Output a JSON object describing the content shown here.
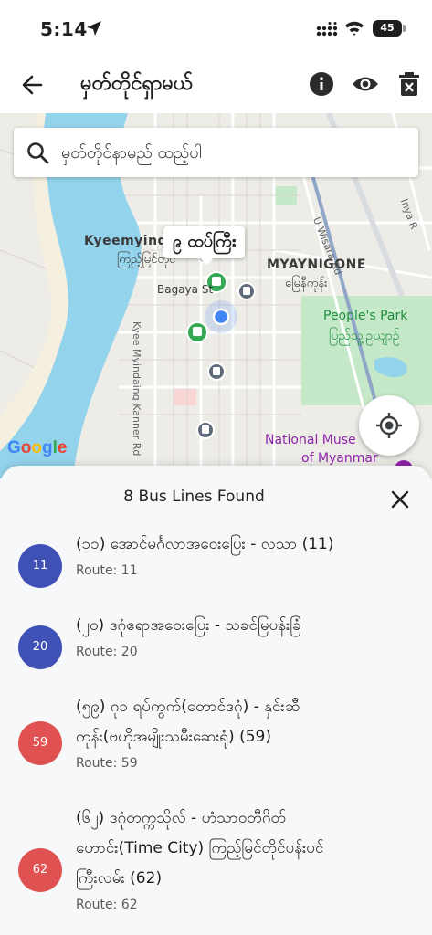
{
  "status_bar": {
    "time": "5:14",
    "battery": "45"
  },
  "app_bar": {
    "title": "မှတ်တိုင်ရှာမယ်"
  },
  "search": {
    "placeholder": "မှတ်တိုင်နာမည် ထည့်ပါ"
  },
  "map": {
    "callout": "၉ ထပ်ကြီး",
    "labels": {
      "kyeemyindaing": "Kyeemyinda",
      "kyeemyindaing_my": "ကြည့်မြင်တိုင်",
      "bagaya": "Bagaya St",
      "myaynigone": "MYAYNIGONE",
      "myaynigone_my": "မြေနီကုန်း",
      "peoples_park": "People's Park",
      "peoples_park_my": "ပြည်သူ့ဥယျာဉ်",
      "national_museum_1": "National Muse",
      "national_museum_2": "of Myanmar",
      "u_wisara": "U Wisara Rd",
      "inya": "Inya R",
      "kyee_myindaing_kanner": "Kyee Myindaing Kanner Rd"
    },
    "google": [
      "G",
      "o",
      "o",
      "g",
      "l",
      "e"
    ]
  },
  "sheet": {
    "title": "8 Bus Lines Found",
    "routes": [
      {
        "badge": "11",
        "color": "#3f51b5",
        "name_lines": [
          "(၁၁) အောင်မင်္ဂလာအဝေးပြေး - လသာ (11)"
        ],
        "sub": "Route: 11"
      },
      {
        "badge": "20",
        "color": "#3f51b5",
        "name_lines": [
          "(၂၀) ဒဂုံဧရာအဝေးပြေး  - သခင်မြပန်းခြံ"
        ],
        "sub": "Route: 20"
      },
      {
        "badge": "59",
        "color": "#e05252",
        "name_lines": [
          "(၅၉) ဂု၁ ရပ်ကွက်(တောင်ဒဂုံ) - နှင်းဆီ",
          "ကုန်း(ဗဟိုအမျိုးသမီးဆေးရုံ) (59)"
        ],
        "sub": "Route: 59"
      },
      {
        "badge": "62",
        "color": "#e05252",
        "name_lines": [
          "(၆၂) ဒဂုံတက္ကသိုလ် - ဟံသာဝတီဂိတ်",
          "ဟောင်း(Time City) ကြည့်မြင်တိုင်ပန်းပင်",
          "ကြီးလမ်း (62)"
        ],
        "sub": "Route: 62"
      }
    ]
  },
  "colors": {
    "river": "#93d3ec",
    "park": "#c5e8c8",
    "route_blue": "#3f51b5",
    "route_red": "#e05252"
  }
}
